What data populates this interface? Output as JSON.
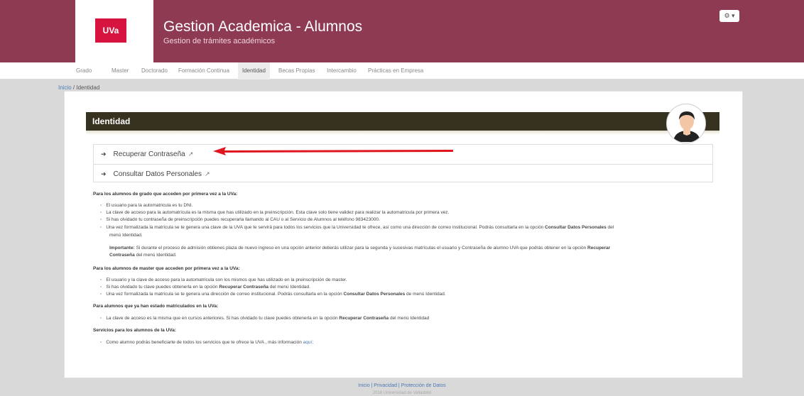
{
  "header": {
    "logo_text": "UVa",
    "title": "Gestion Academica - Alumnos",
    "subtitle": "Gestion de trámites académicos",
    "user_menu": "⚙ ▾"
  },
  "nav": {
    "items": [
      {
        "label": "Grado"
      },
      {
        "label": "Master"
      },
      {
        "label": "Doctorado"
      },
      {
        "label": "Formación Continua"
      },
      {
        "label": "Identidad"
      },
      {
        "label": "Becas Propias"
      },
      {
        "label": "Intercambio"
      },
      {
        "label": "Prácticas en Empresa"
      }
    ],
    "active": "Identidad"
  },
  "breadcrumb": {
    "home": "Inicio",
    "sep": " / ",
    "current": "Identidad"
  },
  "panel": {
    "title": "Identidad",
    "links": [
      {
        "label": "Recuperar Contraseña"
      },
      {
        "label": "Consultar Datos Personales"
      }
    ]
  },
  "sections": {
    "grado": {
      "heading": "Para los alumnos de grado que acceden por primera vez a la UVa:",
      "b1": "El usuario para la automatricula es tu DNI.",
      "b2": "La clave de acceso para la automatrícula es la misma que has utilizado en la preinscripción. Esta clave solo tiene validez para realizar la automatricula por primera vez.",
      "b3": "Si has olvidado tu contraseña de preinscripción puedes recuperarla llamando al CAU o al Servicio de Alumnos al teléfono 983423000.",
      "b4a": "Una vez formalizada la matrícula se te genera una clave de la UVA que te servirá para todos los servicios que la Universidad te ofrece, así como una dirección de correo institucional. Podrás consultarla en la opción",
      "b4b": "Consultar Datos Personales",
      "b4c": "del",
      "b4d": "menú Identidad.",
      "imp_label": "Importante:",
      "imp_a": "Si durante el proceso de admisión obtienes plaza de nuevo ingreso en una opción anterior deberás utilizar para la segunda y sucesivas matrículas el usuario y Contraseña de alumno UVA que podrás obtener en la opción",
      "imp_b": "Recuperar",
      "imp_c": "Contraseña",
      "imp_d": "del menú Identidad."
    },
    "master": {
      "heading": "Para los alumnos de master que acceden por primera vez a la UVa:",
      "b1": "El usuario y la clave de acceso para la automatrícula son los mismos que has utilizado en la preinscripción de master.",
      "b2a": "Si has olvidado tu clave puedes obtenerla en la opción",
      "b2b": "Recuperar Contraseña",
      "b2c": "del menú Identidad.",
      "b3a": "Una vez formalizada la matrícula se te genera una dirección de correo institucional. Podrás consultarla en la opción",
      "b3b": "Consultar Datos Personales",
      "b3c": "de menú Identidad."
    },
    "previos": {
      "heading": "Para alumnos que ya han estado matriculados en la UVa:",
      "b1a": "La clave de acceso es la misma que en cursos anteriores. Si has olvidado tu clave puedes obtenerla en la opción",
      "b1b": "Recuperar Contraseña",
      "b1c": "del menú Identidad"
    },
    "servicios": {
      "heading": "Servicios para los alumnos de la UVa:",
      "b1a": "Como alumno podrás beneficiarte de todos los servicios que te ofrece la UVA , más información",
      "b1b": "aquí;"
    }
  },
  "footer": {
    "links": "Inicio | Privacidad | Protección de Datos",
    "copy": "2018 Universidad de Valladolid"
  },
  "icons": {
    "arrow": "arrow-right-icon",
    "external": "external-link-icon",
    "avatar": "user-avatar-icon",
    "settings": "gear-icon"
  }
}
